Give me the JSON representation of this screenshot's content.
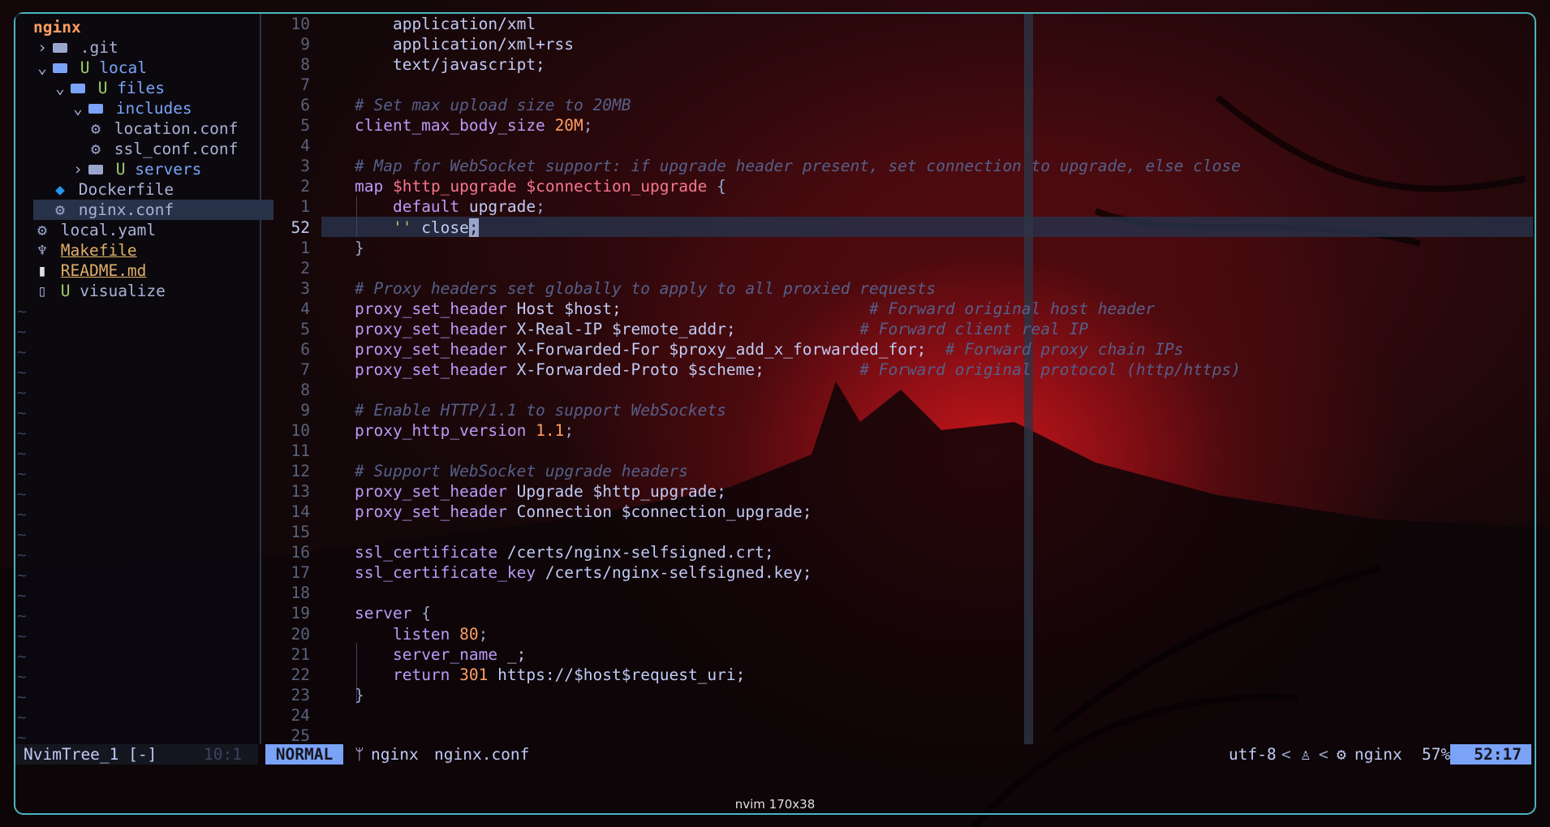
{
  "tree": {
    "root": "nginx",
    "items": [
      {
        "depth": 0,
        "kind": "folder",
        "expanded": false,
        "label": ".git",
        "git": ""
      },
      {
        "depth": 0,
        "kind": "folder",
        "expanded": true,
        "label": "local",
        "git": "U"
      },
      {
        "depth": 1,
        "kind": "folder",
        "expanded": true,
        "label": "files",
        "git": "U"
      },
      {
        "depth": 2,
        "kind": "folder",
        "expanded": true,
        "label": "includes",
        "git": ""
      },
      {
        "depth": 3,
        "kind": "file",
        "icon": "gear",
        "label": "location.conf",
        "git": ""
      },
      {
        "depth": 3,
        "kind": "file",
        "icon": "gear",
        "label": "ssl_conf.conf",
        "git": ""
      },
      {
        "depth": 2,
        "kind": "folder",
        "expanded": false,
        "label": "servers",
        "git": "U"
      },
      {
        "depth": 1,
        "kind": "file",
        "icon": "docker",
        "label": "Dockerfile",
        "git": ""
      },
      {
        "depth": 1,
        "kind": "file",
        "icon": "gear",
        "label": "nginx.conf",
        "git": "",
        "selected": true
      },
      {
        "depth": 0,
        "kind": "file",
        "icon": "gear",
        "label": "local.yaml",
        "git": ""
      },
      {
        "depth": 0,
        "kind": "file",
        "icon": "make",
        "label": "Makefile",
        "git": "",
        "style": "gold"
      },
      {
        "depth": 0,
        "kind": "file",
        "icon": "doc",
        "label": "README.md",
        "git": "",
        "style": "gold"
      },
      {
        "depth": 0,
        "kind": "file",
        "icon": "file",
        "label": "visualize",
        "git": "U"
      }
    ],
    "tilde": "~"
  },
  "editor": {
    "current_line": "52",
    "lines": [
      {
        "n": "10",
        "tokens": [
          [
            "    application/xml",
            "str"
          ]
        ]
      },
      {
        "n": "9",
        "tokens": [
          [
            "    application/xml+rss",
            "str"
          ]
        ]
      },
      {
        "n": "8",
        "tokens": [
          [
            "    text/javascript;",
            "str"
          ]
        ]
      },
      {
        "n": "7",
        "tokens": []
      },
      {
        "n": "6",
        "tokens": [
          [
            "# Set max upload size to 20MB",
            "cm"
          ]
        ]
      },
      {
        "n": "5",
        "tokens": [
          [
            "client_max_body_size",
            "kw"
          ],
          [
            " ",
            "str"
          ],
          [
            "20M",
            "nm"
          ],
          [
            ";",
            "pn"
          ]
        ]
      },
      {
        "n": "4",
        "tokens": []
      },
      {
        "n": "3",
        "tokens": [
          [
            "# Map for WebSocket support: if upgrade header present, set connection to upgrade, else close",
            "cm"
          ]
        ]
      },
      {
        "n": "2",
        "tokens": [
          [
            "map",
            "kw"
          ],
          [
            " ",
            "str"
          ],
          [
            "$http_upgrade",
            "vr"
          ],
          [
            " ",
            "str"
          ],
          [
            "$connection_upgrade",
            "vr"
          ],
          [
            " {",
            "pn"
          ]
        ]
      },
      {
        "n": "1",
        "tokens": [
          [
            "    ",
            "str"
          ],
          [
            "default",
            "kw"
          ],
          [
            " upgrade",
            "str"
          ],
          [
            ";",
            "pn"
          ]
        ]
      },
      {
        "n": "52",
        "tokens": [
          [
            "    ",
            "str"
          ],
          [
            "''",
            "green"
          ],
          [
            " close",
            "str"
          ],
          [
            ";",
            "cursor"
          ]
        ],
        "current": true
      },
      {
        "n": "1",
        "tokens": [
          [
            "}",
            "pn"
          ]
        ]
      },
      {
        "n": "2",
        "tokens": []
      },
      {
        "n": "3",
        "tokens": [
          [
            "# Proxy headers set globally to apply to all proxied requests",
            "cm"
          ]
        ]
      },
      {
        "n": "4",
        "tokens": [
          [
            "proxy_set_header",
            "kw"
          ],
          [
            " Host $host;                          ",
            "str"
          ],
          [
            "# Forward original host header",
            "cm"
          ]
        ]
      },
      {
        "n": "5",
        "tokens": [
          [
            "proxy_set_header",
            "kw"
          ],
          [
            " X-Real-IP $remote_addr;             ",
            "str"
          ],
          [
            "# Forward client real IP",
            "cm"
          ]
        ]
      },
      {
        "n": "6",
        "tokens": [
          [
            "proxy_set_header",
            "kw"
          ],
          [
            " X-Forwarded-For $proxy_add_x_forwarded_for;  ",
            "str"
          ],
          [
            "# Forward proxy chain IPs",
            "cm"
          ]
        ]
      },
      {
        "n": "7",
        "tokens": [
          [
            "proxy_set_header",
            "kw"
          ],
          [
            " X-Forwarded-Proto $scheme;          ",
            "str"
          ],
          [
            "# Forward original protocol (http/https)",
            "cm"
          ]
        ]
      },
      {
        "n": "8",
        "tokens": []
      },
      {
        "n": "9",
        "tokens": [
          [
            "# Enable HTTP/1.1 to support WebSockets",
            "cm"
          ]
        ]
      },
      {
        "n": "10",
        "tokens": [
          [
            "proxy_http_version",
            "kw"
          ],
          [
            " ",
            "str"
          ],
          [
            "1.1",
            "nm"
          ],
          [
            ";",
            "pn"
          ]
        ]
      },
      {
        "n": "11",
        "tokens": []
      },
      {
        "n": "12",
        "tokens": [
          [
            "# Support WebSocket upgrade headers",
            "cm"
          ]
        ]
      },
      {
        "n": "13",
        "tokens": [
          [
            "proxy_set_header",
            "kw"
          ],
          [
            " Upgrade $http_upgrade;",
            "str"
          ]
        ]
      },
      {
        "n": "14",
        "tokens": [
          [
            "proxy_set_header",
            "kw"
          ],
          [
            " Connection $connection_upgrade;",
            "str"
          ]
        ]
      },
      {
        "n": "15",
        "tokens": []
      },
      {
        "n": "16",
        "tokens": [
          [
            "ssl_certificate",
            "kw"
          ],
          [
            " /certs/nginx-selfsigned.crt;",
            "str"
          ]
        ]
      },
      {
        "n": "17",
        "tokens": [
          [
            "ssl_certificate_key",
            "kw"
          ],
          [
            " /certs/nginx-selfsigned.key;",
            "str"
          ]
        ]
      },
      {
        "n": "18",
        "tokens": []
      },
      {
        "n": "19",
        "tokens": [
          [
            "server",
            "kw"
          ],
          [
            " {",
            "pn"
          ]
        ]
      },
      {
        "n": "20",
        "tokens": [
          [
            "    ",
            "str"
          ],
          [
            "listen",
            "kw"
          ],
          [
            " ",
            "str"
          ],
          [
            "80",
            "nm"
          ],
          [
            ";",
            "pn"
          ]
        ]
      },
      {
        "n": "21",
        "tokens": [
          [
            "    ",
            "str"
          ],
          [
            "server_name",
            "kw"
          ],
          [
            " _;",
            "str"
          ]
        ]
      },
      {
        "n": "22",
        "tokens": [
          [
            "    ",
            "str"
          ],
          [
            "return",
            "kw"
          ],
          [
            " ",
            "str"
          ],
          [
            "301",
            "nm"
          ],
          [
            " https://$host$request_uri;",
            "str"
          ]
        ]
      },
      {
        "n": "23",
        "tokens": [
          [
            "}",
            "pn"
          ]
        ]
      },
      {
        "n": "24",
        "tokens": []
      },
      {
        "n": "25",
        "tokens": []
      }
    ]
  },
  "statusline": {
    "tree_name": "NvimTree_1 [-]",
    "tree_pos": "10:1",
    "mode": "NORMAL",
    "branch_icon": "ᛘ",
    "branch": "nginx",
    "filename": "nginx.conf",
    "encoding": "utf-8",
    "sep": "<",
    "os_icon": "♙",
    "project": "nginx",
    "percent": "57%",
    "position": "52:17"
  },
  "terminal_title": "nvim 170x38",
  "colors": {
    "accent": "#7aa2f7",
    "frame": "#48b6be",
    "keyword": "#bb9af7",
    "number": "#ff9e64",
    "variable": "#f7768e",
    "comment": "#565f89"
  }
}
